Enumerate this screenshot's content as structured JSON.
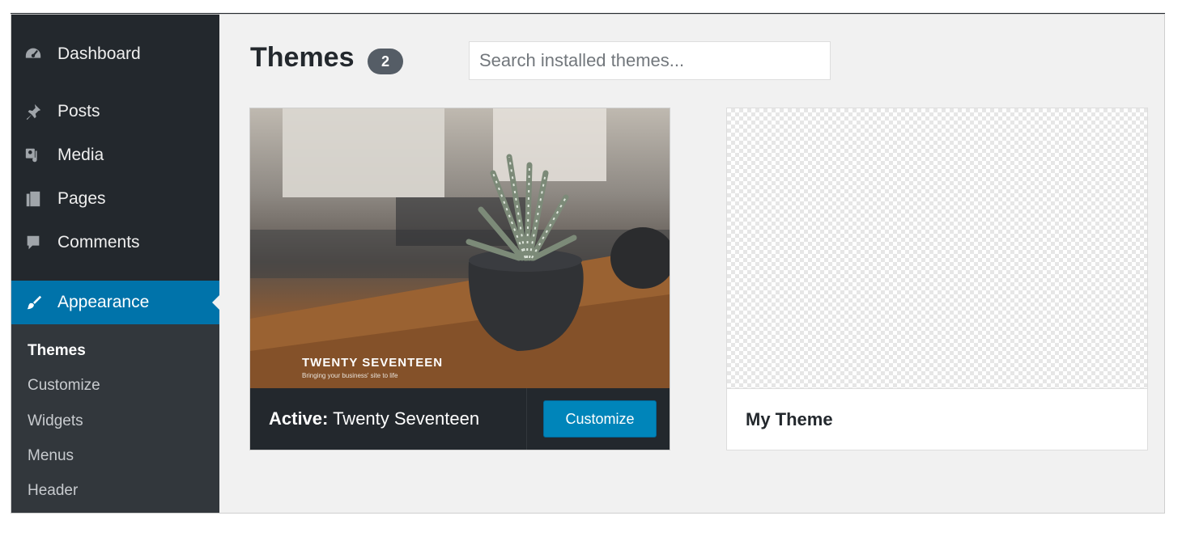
{
  "sidebar": {
    "items": [
      {
        "label": "Dashboard",
        "icon": "dashboard-icon"
      },
      {
        "label": "Posts",
        "icon": "pin-icon"
      },
      {
        "label": "Media",
        "icon": "media-icon"
      },
      {
        "label": "Pages",
        "icon": "pages-icon"
      },
      {
        "label": "Comments",
        "icon": "comments-icon"
      },
      {
        "label": "Appearance",
        "icon": "paintbrush-icon",
        "active": true
      }
    ],
    "submenu": [
      "Themes",
      "Customize",
      "Widgets",
      "Menus",
      "Header"
    ],
    "current_submenu": "Themes"
  },
  "main": {
    "title": "Themes",
    "count": "2",
    "search_placeholder": "Search installed themes..."
  },
  "themes": [
    {
      "name": "Twenty Seventeen",
      "active_prefix": "Active:",
      "screenshot_title": "TWENTY SEVENTEEN",
      "screenshot_subtitle": "Bringing your business' site to life",
      "button_label": "Customize",
      "active": true
    },
    {
      "name": "My Theme",
      "active": false
    }
  ],
  "colors": {
    "sidebar_bg": "#23282d",
    "accent": "#0073aa",
    "button": "#0085ba",
    "content_bg": "#f1f1f1"
  }
}
